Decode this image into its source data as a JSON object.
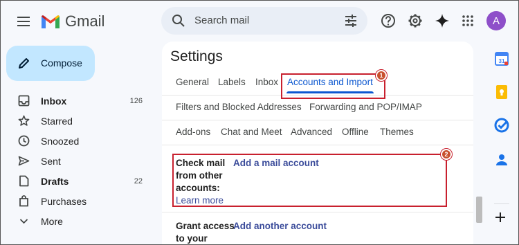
{
  "app": {
    "name": "Gmail"
  },
  "search": {
    "placeholder": "Search mail"
  },
  "account": {
    "initial": "A",
    "color": "#8e4fc9"
  },
  "sidebar": {
    "compose_label": "Compose",
    "items": [
      {
        "label": "Inbox",
        "count": "126",
        "icon": "inbox-icon",
        "bold": true
      },
      {
        "label": "Starred",
        "count": "",
        "icon": "star-icon",
        "bold": false
      },
      {
        "label": "Snoozed",
        "count": "",
        "icon": "clock-icon",
        "bold": false
      },
      {
        "label": "Sent",
        "count": "",
        "icon": "send-icon",
        "bold": false
      },
      {
        "label": "Drafts",
        "count": "22",
        "icon": "draft-icon",
        "bold": true
      },
      {
        "label": "Purchases",
        "count": "",
        "icon": "tag-icon",
        "bold": false
      },
      {
        "label": "More",
        "count": "",
        "icon": "chevron-down-icon",
        "bold": false
      }
    ]
  },
  "settings": {
    "title": "Settings",
    "tabs_row1": [
      "General",
      "Labels",
      "Inbox",
      "Accounts and Import"
    ],
    "tabs_row2": [
      "Filters and Blocked Addresses",
      "Forwarding and POP/IMAP"
    ],
    "tabs_row3": [
      "Add-ons",
      "Chat and Meet",
      "Advanced",
      "Offline",
      "Themes"
    ],
    "active_tab": "Accounts and Import",
    "check_mail": {
      "label_line1": "Check mail",
      "label_line2": "from other",
      "label_line3": "accounts:",
      "learn_more": "Learn more",
      "action": "Add a mail account"
    },
    "grant_access": {
      "label_line1": "Grant access",
      "label_line2": "to your",
      "action": "Add another account"
    }
  },
  "annotations": {
    "callout1": "1",
    "callout2": "2",
    "highlight_color": "#c8202e"
  },
  "colors": {
    "accent": "#0b57d0",
    "compose_bg": "#c2e7ff",
    "link": "#3a4b9a"
  }
}
